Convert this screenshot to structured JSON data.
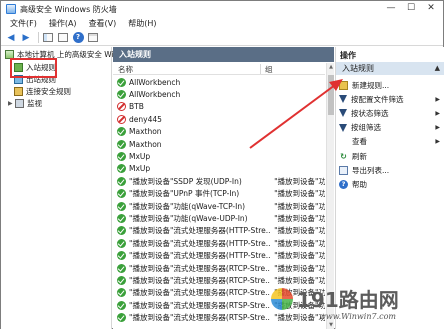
{
  "window": {
    "title": "高级安全 Windows 防火墙",
    "controls": [
      "—",
      "☐",
      "✕"
    ]
  },
  "menu": [
    "文件(F)",
    "操作(A)",
    "查看(V)",
    "帮助(H)"
  ],
  "tree": {
    "root": "本地计算机 上的高级安全 Windo",
    "items": [
      "入站规则",
      "出站规则",
      "连接安全规则",
      "监视"
    ]
  },
  "middle": {
    "title": "入站规则",
    "columns": {
      "name": "名称",
      "group": "组"
    },
    "rules": [
      {
        "name": "AllWorkbench",
        "group": "",
        "status": "allow"
      },
      {
        "name": "AllWorkbench",
        "group": "",
        "status": "allow"
      },
      {
        "name": "BTB",
        "group": "",
        "status": "block"
      },
      {
        "name": "deny445",
        "group": "",
        "status": "block"
      },
      {
        "name": "Maxthon",
        "group": "",
        "status": "allow"
      },
      {
        "name": "Maxthon",
        "group": "",
        "status": "allow"
      },
      {
        "name": "MxUp",
        "group": "",
        "status": "allow"
      },
      {
        "name": "MxUp",
        "group": "",
        "status": "allow"
      },
      {
        "name": "\"播放到设备\"SSDP 发现(UDP-In)",
        "group": "\"播放到设备\"功能",
        "status": "allow"
      },
      {
        "name": "\"播放到设备\"UPnP 事件(TCP-In)",
        "group": "\"播放到设备\"功能",
        "status": "allow"
      },
      {
        "name": "\"播放到设备\"功能(qWave-TCP-In)",
        "group": "\"播放到设备\"功能",
        "status": "allow"
      },
      {
        "name": "\"播放到设备\"功能(qWave-UDP-In)",
        "group": "\"播放到设备\"功能",
        "status": "allow"
      },
      {
        "name": "\"播放到设备\"流式处理服务器(HTTP-Stre...",
        "group": "\"播放到设备\"功能",
        "status": "allow"
      },
      {
        "name": "\"播放到设备\"流式处理服务器(HTTP-Stre...",
        "group": "\"播放到设备\"功能",
        "status": "allow"
      },
      {
        "name": "\"播放到设备\"流式处理服务器(HTTP-Stre...",
        "group": "\"播放到设备\"功能",
        "status": "allow"
      },
      {
        "name": "\"播放到设备\"流式处理服务器(RTCP-Stre...",
        "group": "\"播放到设备\"功能",
        "status": "allow"
      },
      {
        "name": "\"播放到设备\"流式处理服务器(RTCP-Stre...",
        "group": "\"播放到设备\"功能",
        "status": "allow"
      },
      {
        "name": "\"播放到设备\"流式处理服务器(RTCP-Stre...",
        "group": "\"播放到设备\"功能",
        "status": "allow"
      },
      {
        "name": "\"播放到设备\"流式处理服务器(RTSP-Stre...",
        "group": "\"播放到设备\"功能",
        "status": "allow"
      },
      {
        "name": "\"播放到设备\"流式处理服务器(RTSP-Stre...",
        "group": "\"播放到设备\"功能",
        "status": "allow"
      }
    ]
  },
  "actions": {
    "title": "操作",
    "section": "入站规则",
    "items": [
      {
        "label": "新建规则...",
        "icon": "new-rule-icon",
        "submenu": false
      },
      {
        "label": "按配置文件筛选",
        "icon": "filter-icon",
        "submenu": true
      },
      {
        "label": "按状态筛选",
        "icon": "filter-icon",
        "submenu": true
      },
      {
        "label": "按组筛选",
        "icon": "filter-icon",
        "submenu": true
      },
      {
        "label": "查看",
        "icon": "view-icon",
        "submenu": true
      },
      {
        "label": "刷新",
        "icon": "refresh-icon",
        "submenu": false
      },
      {
        "label": "导出列表...",
        "icon": "export-icon",
        "submenu": false
      },
      {
        "label": "帮助",
        "icon": "help-icon",
        "submenu": false
      }
    ]
  },
  "watermark": {
    "main": "191路由网",
    "sub": "www.Winwin7.com"
  },
  "colors": {
    "header_bg": "#5a6e86",
    "section_bg": "#d8e4f0",
    "annotation": "#e03131",
    "allow": "#3aa03a",
    "block": "#d23030"
  }
}
